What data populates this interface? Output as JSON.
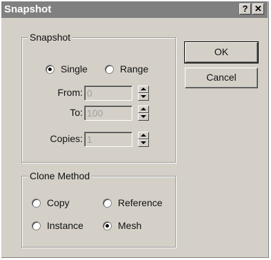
{
  "window": {
    "title": "Snapshot",
    "help_label": "?",
    "close_label": "✕"
  },
  "snapshot_group": {
    "label": "Snapshot",
    "modes": [
      {
        "label": "Single",
        "checked": true
      },
      {
        "label": "Range",
        "checked": false
      }
    ],
    "from": {
      "label": "From:",
      "value": "0"
    },
    "to": {
      "label": "To:",
      "value": "100"
    },
    "copies": {
      "label": "Copies:",
      "value": "1"
    }
  },
  "clone_group": {
    "label": "Clone Method",
    "options": [
      {
        "label": "Copy",
        "checked": false
      },
      {
        "label": "Reference",
        "checked": false
      },
      {
        "label": "Instance",
        "checked": false
      },
      {
        "label": "Mesh",
        "checked": true
      }
    ]
  },
  "buttons": {
    "ok_label": "OK",
    "cancel_label": "Cancel"
  }
}
